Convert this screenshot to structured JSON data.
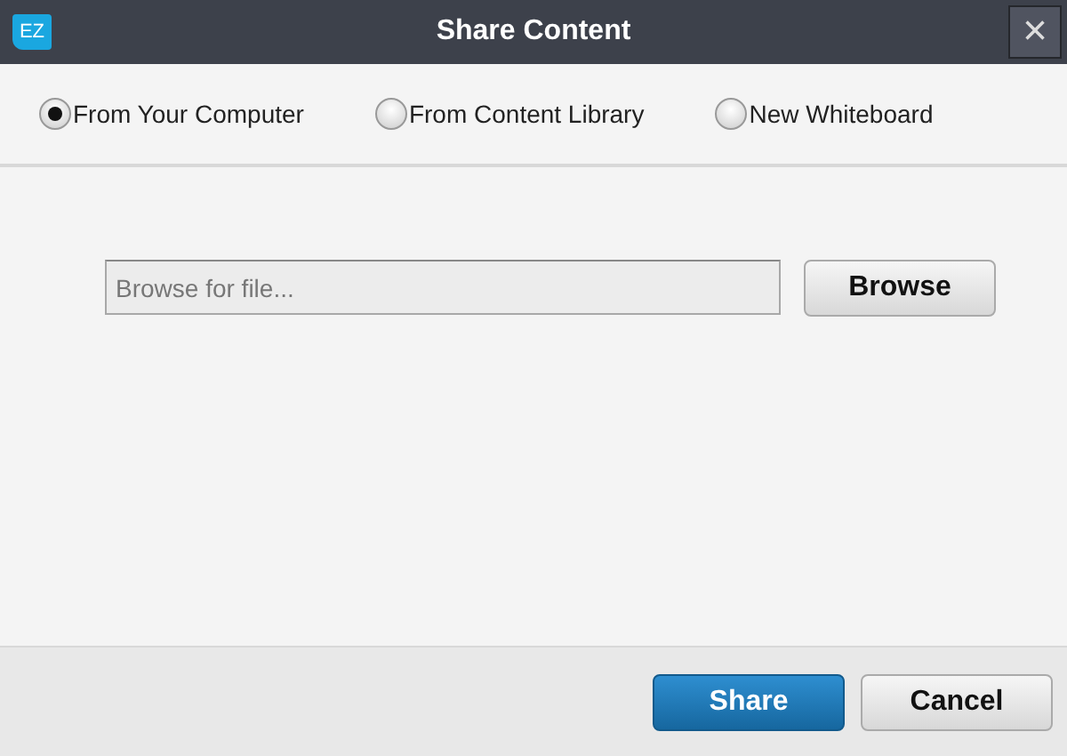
{
  "window": {
    "logo": "EZ",
    "title": "Share Content",
    "close": "×"
  },
  "sources": [
    {
      "label": "From Your Computer",
      "selected": true
    },
    {
      "label": "From Content Library",
      "selected": false
    },
    {
      "label": "New Whiteboard",
      "selected": false
    }
  ],
  "file_field": {
    "placeholder": "Browse for file..."
  },
  "browse_button": "Browse",
  "buttons": [
    {
      "label": "Share",
      "kind": "primary"
    },
    {
      "label": "Cancel",
      "kind": "secondary"
    }
  ]
}
